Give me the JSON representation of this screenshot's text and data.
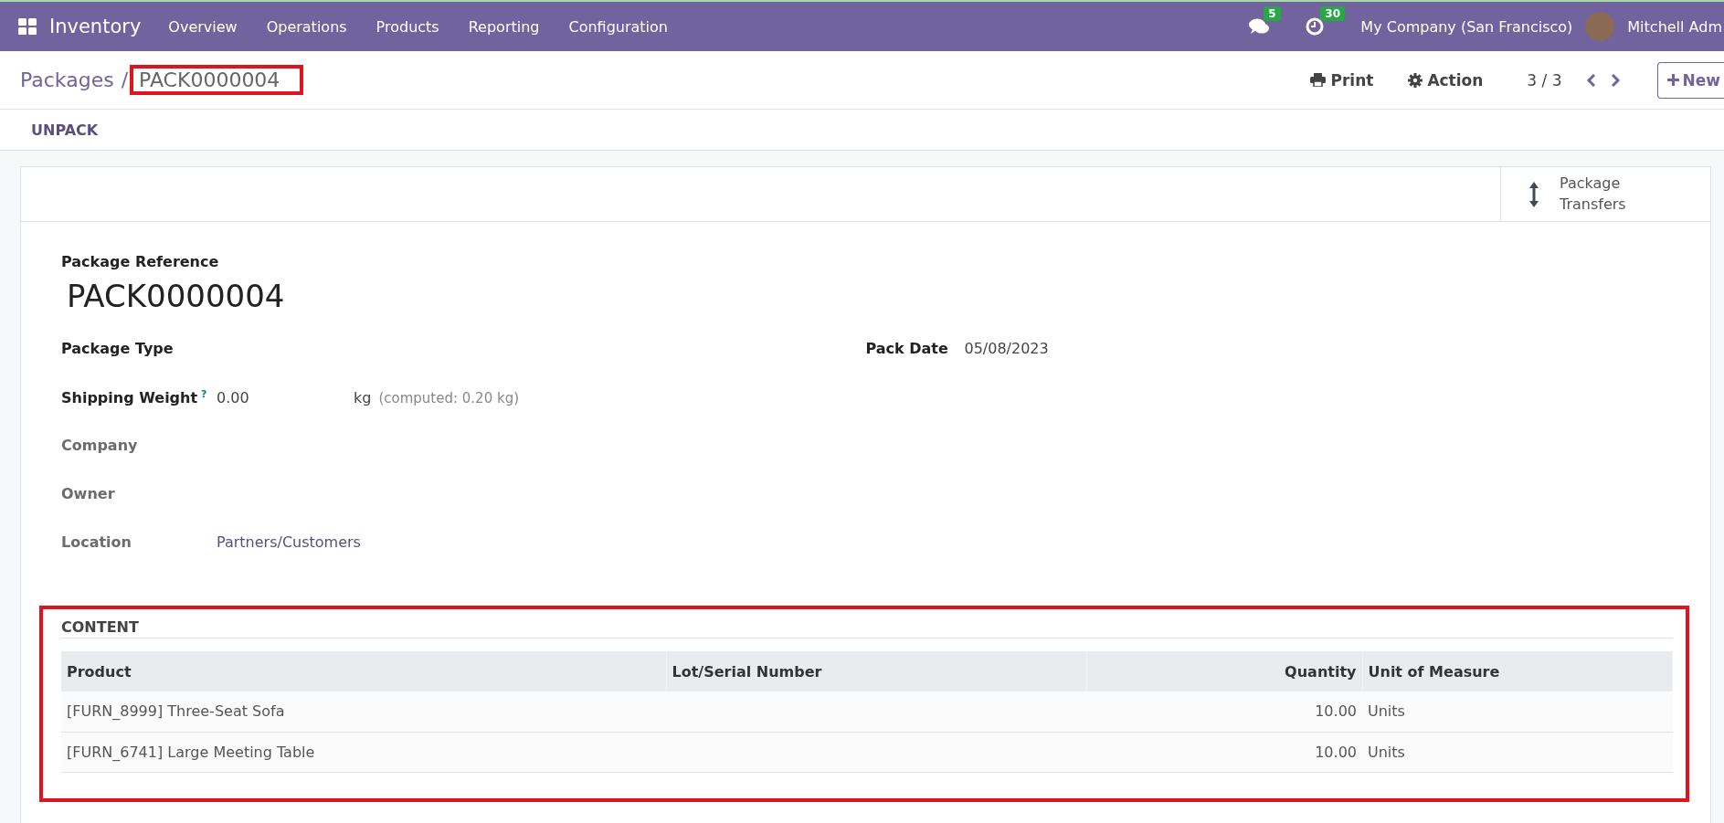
{
  "navbar": {
    "app_name": "Inventory",
    "menu": [
      {
        "label": "Overview"
      },
      {
        "label": "Operations"
      },
      {
        "label": "Products"
      },
      {
        "label": "Reporting"
      },
      {
        "label": "Configuration"
      }
    ],
    "messages_count": "5",
    "activities_count": "30",
    "company": "My Company (San Francisco)",
    "user": "Mitchell Adm"
  },
  "breadcrumb": {
    "parent": "Packages",
    "separator": "/",
    "current": "PACK0000004"
  },
  "control_panel": {
    "print": "Print",
    "action": "Action",
    "pager": "3 / 3",
    "new": "New"
  },
  "status_buttons": [
    "UNPACK"
  ],
  "stat_button": {
    "label": "Package Transfers"
  },
  "form": {
    "reference_label": "Package Reference",
    "reference": "PACK0000004",
    "left_fields": [
      {
        "label": "Package Type",
        "required": true
      },
      {
        "label": "Shipping Weight",
        "help": "?",
        "value": "0.00",
        "unit": "kg",
        "computed": "(computed: 0.20 kg)",
        "required": true
      },
      {
        "label": "Company",
        "required": false
      },
      {
        "label": "Owner",
        "required": false
      },
      {
        "label": "Location",
        "value": "Partners/Customers",
        "required": false
      }
    ],
    "right_fields": [
      {
        "label": "Pack Date",
        "value": "05/08/2023",
        "required": true
      }
    ]
  },
  "content": {
    "title": "CONTENT",
    "columns": [
      {
        "label": "Product"
      },
      {
        "label": "Lot/Serial Number"
      },
      {
        "label": "Quantity"
      },
      {
        "label": "Unit of Measure"
      }
    ],
    "rows": [
      [
        "[FURN_8999] Three-Seat Sofa",
        "",
        "10.00",
        "Units"
      ],
      [
        "[FURN_6741] Large Meeting Table",
        "",
        "10.00",
        "Units"
      ]
    ]
  }
}
